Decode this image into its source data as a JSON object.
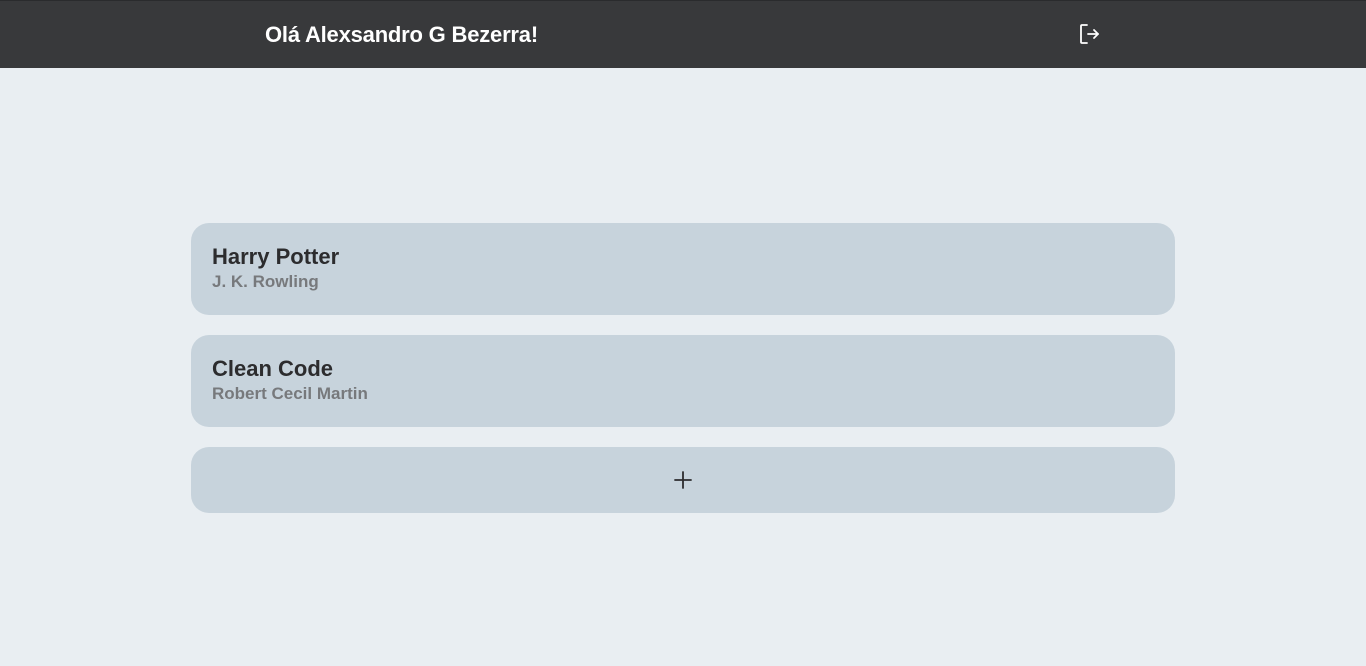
{
  "header": {
    "greeting": "Olá Alexsandro G Bezerra!",
    "logout_icon": "logout-icon"
  },
  "books": [
    {
      "title": "Harry Potter",
      "author": "J. K. Rowling"
    },
    {
      "title": "Clean Code",
      "author": "Robert Cecil Martin"
    }
  ],
  "add_button": {
    "icon": "plus-icon"
  },
  "colors": {
    "background": "#e9eef2",
    "topbar": "#38393b",
    "card": "#c7d3dc",
    "title_text": "#2c2c2e",
    "author_text": "#77797c"
  }
}
